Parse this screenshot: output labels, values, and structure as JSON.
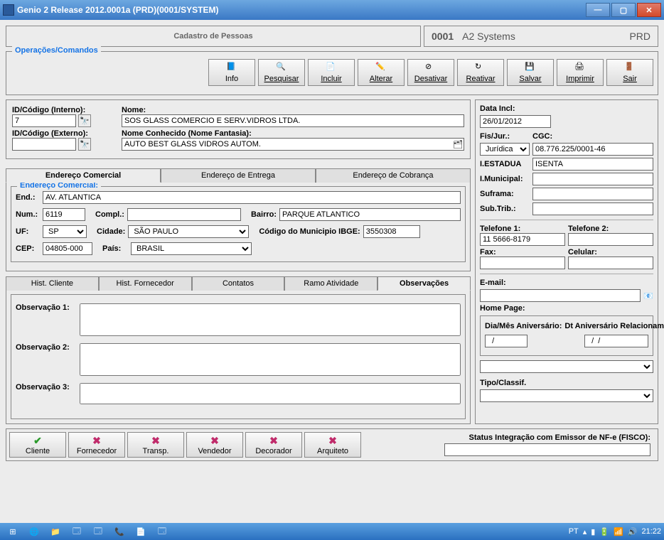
{
  "window": {
    "title": "Genio 2 Release 2012.0001a (PRD)(0001/SYSTEM)"
  },
  "header": {
    "title": "Cadastro de Pessoas",
    "code": "0001",
    "system": "A2 Systems",
    "env": "PRD"
  },
  "ops_legend": "Operações/Comandos",
  "toolbar": {
    "info": "Info",
    "pesquisar": "Pesquisar",
    "incluir": "Incluir",
    "alterar": "Alterar",
    "desativar": "Desativar",
    "reativar": "Reativar",
    "salvar": "Salvar",
    "imprimir": "Imprimir",
    "sair": "Sair"
  },
  "ids": {
    "interno_label": "ID/Código (Interno):",
    "interno_val": "7",
    "externo_label": "ID/Código (Externo):",
    "externo_val": "",
    "nome_label": "Nome:",
    "nome_val": "SOS GLASS COMERCIO E SERV.VIDROS LTDA.",
    "fantasia_label": "Nome Conhecido (Nome Fantasia):",
    "fantasia_val": "AUTO BEST GLASS VIDROS AUTOM."
  },
  "addr_tabs": {
    "t1": "Endereço Comercial",
    "t2": "Endereço de Entrega",
    "t3": "Endereço de Cobrança"
  },
  "addr": {
    "legend": "Endereço Comercial:",
    "end_label": "End.:",
    "end_val": "AV. ATLANTICA",
    "num_label": "Num.:",
    "num_val": "6119",
    "compl_label": "Compl.:",
    "compl_val": "",
    "bairro_label": "Bairro:",
    "bairro_val": "PARQUE ATLANTICO",
    "uf_label": "UF:",
    "uf_val": "SP",
    "cidade_label": "Cidade:",
    "cidade_val": "SÃO PAULO",
    "ibge_label": "Código do Municipio IBGE:",
    "ibge_val": "3550308",
    "cep_label": "CEP:",
    "cep_val": "04805-000",
    "pais_label": "País:",
    "pais_val": "BRASIL"
  },
  "lower_tabs": {
    "t1": "Hist. Cliente",
    "t2": "Hist. Fornecedor",
    "t3": "Contatos",
    "t4": "Ramo Atividade",
    "t5": "Observações"
  },
  "obs": {
    "l1": "Observação 1:",
    "l2": "Observação 2:",
    "l3": "Observação 3:",
    "v1": "",
    "v2": "",
    "v3": ""
  },
  "right": {
    "data_incl_label": "Data Incl:",
    "data_incl_val": "26/01/2012",
    "fisjur_label": "Fis/Jur.:",
    "fisjur_val": "Jurídica",
    "cgc_label": "CGC:",
    "cgc_val": "08.776.225/0001-46",
    "iestadua_label": "I.ESTADUA",
    "iestadua_val": "ISENTA",
    "imunicipal_label": "I.Municipal:",
    "imunicipal_val": "",
    "suframa_label": "Suframa:",
    "suframa_val": "",
    "subtrib_label": "Sub.Trib.:",
    "subtrib_val": "",
    "tel1_label": "Telefone 1:",
    "tel1_val": "11 5666-8179",
    "tel2_label": "Telefone 2:",
    "tel2_val": "",
    "fax_label": "Fax:",
    "fax_val": "",
    "cel_label": "Celular:",
    "cel_val": "",
    "email_label": "E-mail:",
    "email_val": "",
    "homepage_label": "Home Page:",
    "homepage_val": "",
    "diames_label": "Dia/Mês Aniversário:",
    "diames_val": "  /",
    "dtaniv_label": "Dt Aniversário Relacionamento:",
    "dtaniv_val": "  /  /",
    "tipo_label": "Tipo/Classif.",
    "tipo_val": ""
  },
  "bottom_btns": {
    "cliente": "Cliente",
    "fornecedor": "Fornecedor",
    "transp": "Transp.",
    "vendedor": "Vendedor",
    "decorador": "Decorador",
    "arquiteto": "Arquiteto"
  },
  "status_nfe": "Status Integração com Emissor de NF-e  (FISCO):",
  "taskbar": {
    "lang": "PT",
    "time": "21:22"
  }
}
